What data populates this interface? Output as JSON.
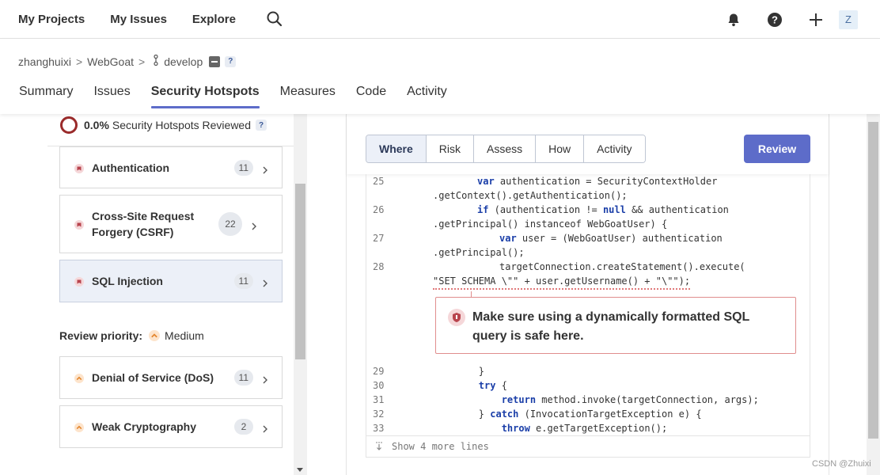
{
  "topnav": {
    "links": [
      "My Projects",
      "My Issues",
      "Explore"
    ],
    "avatar_letter": "Z"
  },
  "breadcrumb": {
    "owner": "zhanghuixi",
    "project": "WebGoat",
    "branch": "develop",
    "sep": ">"
  },
  "tabs": [
    "Summary",
    "Issues",
    "Security Hotspots",
    "Measures",
    "Code",
    "Activity"
  ],
  "sidebar": {
    "reviewed_pct": "0.0%",
    "reviewed_label": "Security Hotspots Reviewed",
    "reviewed_fraction": 0,
    "categories_high": [
      {
        "label": "Authentication",
        "count": "11"
      },
      {
        "label": "Cross-Site Request Forgery (CSRF)",
        "count": "22"
      },
      {
        "label": "SQL Injection",
        "count": "11"
      }
    ],
    "priority_label": "Review priority:",
    "priority_value": "Medium",
    "categories_medium": [
      {
        "label": "Denial of Service (DoS)",
        "count": "11"
      },
      {
        "label": "Weak Cryptography",
        "count": "2"
      }
    ],
    "help": "?"
  },
  "detail": {
    "tabs": [
      "Where",
      "Risk",
      "Assess",
      "How",
      "Activity"
    ],
    "review_button": "Review",
    "code_lines": [
      {
        "n": "25",
        "text": "        var authentication = SecurityContextHolder"
      },
      {
        "n": "",
        "text": ".getContext().getAuthentication();"
      },
      {
        "n": "26",
        "text": "        if (authentication != null && authentication"
      },
      {
        "n": "",
        "text": ".getPrincipal() instanceof WebGoatUser) {"
      },
      {
        "n": "27",
        "text": "            var user = (WebGoatUser) authentication"
      },
      {
        "n": "",
        "text": ".getPrincipal();"
      },
      {
        "n": "28",
        "text": "            targetConnection.createStatement().execute("
      },
      {
        "n": "",
        "text": "\"SET SCHEMA \\\"\" + user.getUsername() + \"\\\"\");"
      },
      {
        "n": "29",
        "text": "        }"
      },
      {
        "n": "30",
        "text": "        try {"
      },
      {
        "n": "31",
        "text": "            return method.invoke(targetConnection, args);"
      },
      {
        "n": "32",
        "text": "        } catch (InvocationTargetException e) {"
      },
      {
        "n": "33",
        "text": "            throw e.getTargetException();"
      }
    ],
    "issue_message": "Make sure using a dynamically formatted SQL query is safe here.",
    "show_more": "Show 4 more lines"
  },
  "colors": {
    "accent": "#5d6cc9",
    "hotspot_high": "#b8434d",
    "hotspot_medium": "#e4862e",
    "issue_border": "#e08d8d"
  },
  "watermark": "CSDN @Zhuixi"
}
